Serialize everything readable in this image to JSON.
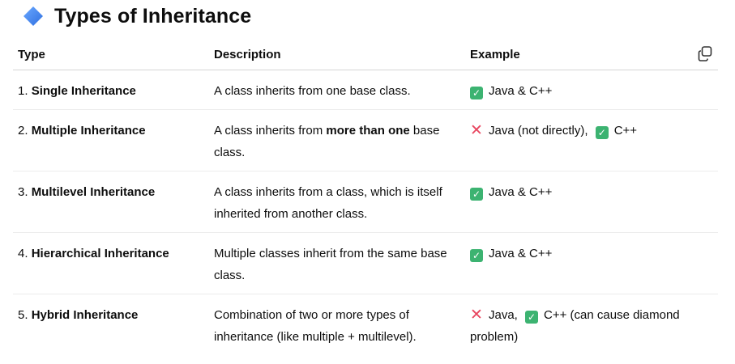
{
  "header": {
    "title": "Types of Inheritance",
    "icon": "blue-diamond-icon",
    "copy_icon": "copy-icon"
  },
  "table": {
    "columns": [
      "Type",
      "Description",
      "Example"
    ],
    "rows": [
      {
        "num": "1. ",
        "type": "Single Inheritance",
        "desc": [
          {
            "t": "A class inherits from one base class.",
            "b": false
          }
        ],
        "example": [
          {
            "icon": "check",
            "t": "Java & C++"
          }
        ]
      },
      {
        "num": "2. ",
        "type": "Multiple Inheritance",
        "desc": [
          {
            "t": "A class inherits from ",
            "b": false
          },
          {
            "t": "more than one",
            "b": true
          },
          {
            "t": " base class.",
            "b": false
          }
        ],
        "example": [
          {
            "icon": "cross",
            "t": "Java (not directly),"
          },
          {
            "icon": "check",
            "t": "C++"
          }
        ]
      },
      {
        "num": "3. ",
        "type": "Multilevel Inheritance",
        "desc": [
          {
            "t": "A class inherits from a class, which is itself inherited from another class.",
            "b": false
          }
        ],
        "example": [
          {
            "icon": "check",
            "t": "Java & C++"
          }
        ]
      },
      {
        "num": "4. ",
        "type": "Hierarchical Inheritance",
        "desc": [
          {
            "t": "Multiple classes inherit from the same base class.",
            "b": false
          }
        ],
        "example": [
          {
            "icon": "check",
            "t": "Java & C++"
          }
        ]
      },
      {
        "num": "5. ",
        "type": "Hybrid Inheritance",
        "desc": [
          {
            "t": "Combination of two or more types of inheritance (like multiple + multilevel).",
            "b": false
          }
        ],
        "example": [
          {
            "icon": "cross",
            "t": "Java,"
          },
          {
            "icon": "check",
            "t": "C++ (can cause diamond problem)"
          }
        ]
      }
    ]
  },
  "colors": {
    "diamond": "#3b82f6",
    "check": "#3cb371",
    "cross": "#e8455f"
  }
}
